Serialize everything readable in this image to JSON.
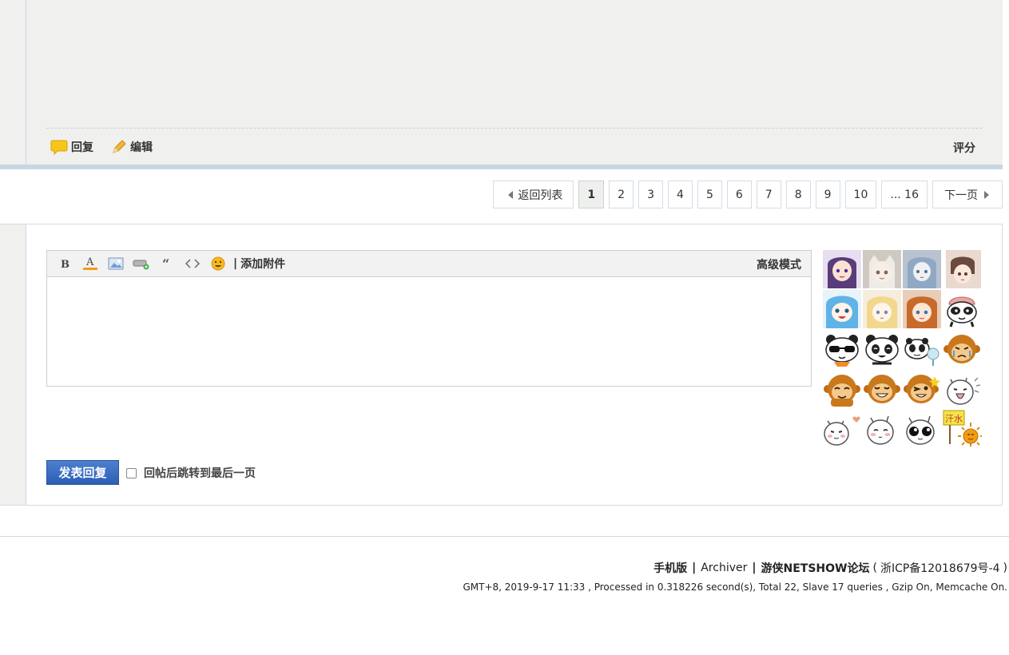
{
  "post": {
    "reply_label": "回复",
    "edit_label": "编辑",
    "rate_label": "评分"
  },
  "pagination": {
    "back_label": "返回列表",
    "pages": [
      "1",
      "2",
      "3",
      "4",
      "5",
      "6",
      "7",
      "8",
      "9",
      "10"
    ],
    "current": "1",
    "last_label": "... 16",
    "next_label": "下一页"
  },
  "editor": {
    "tools": [
      "bold-icon",
      "font-color-icon",
      "image-icon",
      "link-icon",
      "quote-icon",
      "code-icon",
      "smiley-icon"
    ],
    "separator": "|",
    "attach_label": "添加附件",
    "advanced_label": "高级模式",
    "content": ""
  },
  "smilies": [
    "anime-girl-purple",
    "anime-cat-girl",
    "anime-blue-hair",
    "anime-brown-hair",
    "anime-squid-girl",
    "anime-blonde",
    "anime-orange-hair",
    "panda-hat",
    "panda-sunglasses",
    "panda-smile",
    "panda-fan",
    "monkey-cry",
    "monkey-shy",
    "monkey-grin",
    "monkey-wink",
    "cat-shout",
    "cat-heart",
    "cat-blush",
    "cat-big-eyes",
    "sun-sweat"
  ],
  "sweat_sign": "汗水",
  "submit_label": "发表回复",
  "jump_label": "回帖后跳转到最后一页",
  "footer": {
    "mobile": "手机版",
    "archiver": "Archiver",
    "forum": "游侠NETSHOW论坛",
    "icp_open": "(",
    "icp": "浙ICP备12018679号-4",
    "icp_close": ")",
    "sep": "|",
    "info": "GMT+8, 2019-9-17 11:33 , Processed in 0.318226 second(s), Total 22, Slave 17 queries , Gzip On, Memcache On."
  }
}
